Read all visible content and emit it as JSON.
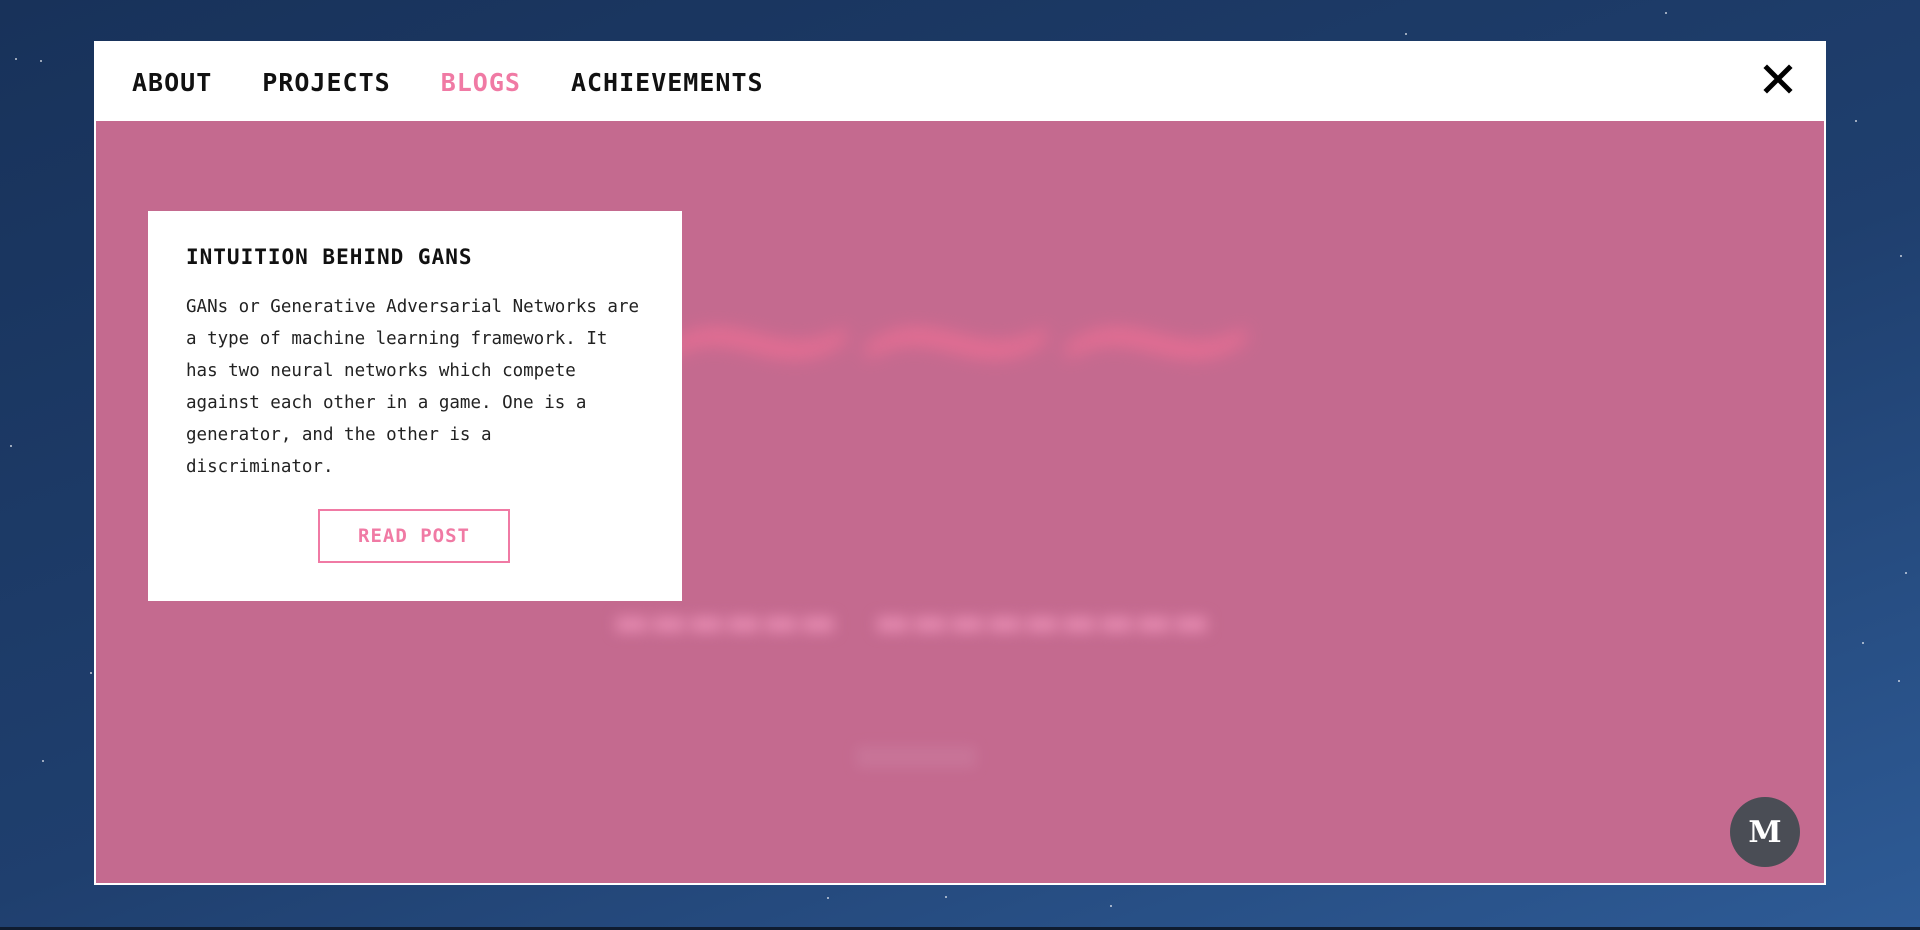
{
  "nav": {
    "items": [
      {
        "label": "ABOUT"
      },
      {
        "label": "PROJECTS"
      },
      {
        "label": "BLOGS"
      },
      {
        "label": "ACHIEVEMENTS"
      }
    ],
    "active_index": 2,
    "close_icon": "close-icon"
  },
  "blog_card": {
    "title": "INTUITION BEHIND GANS",
    "excerpt": "GANs or Generative Adversarial Networks are a type of machine learning framework. It has two neural networks which compete against each other in a game. One is a generator, and the other is a discriminator.",
    "button_label": "READ POST"
  },
  "medium_button": {
    "label": "M",
    "icon": "medium-icon"
  },
  "colors": {
    "accent": "#f07aa4",
    "content_bg": "#c46a8f",
    "page_bg": "#1f3f6e",
    "nav_bg": "#ffffff",
    "medium_btn": "#4a4d55"
  }
}
